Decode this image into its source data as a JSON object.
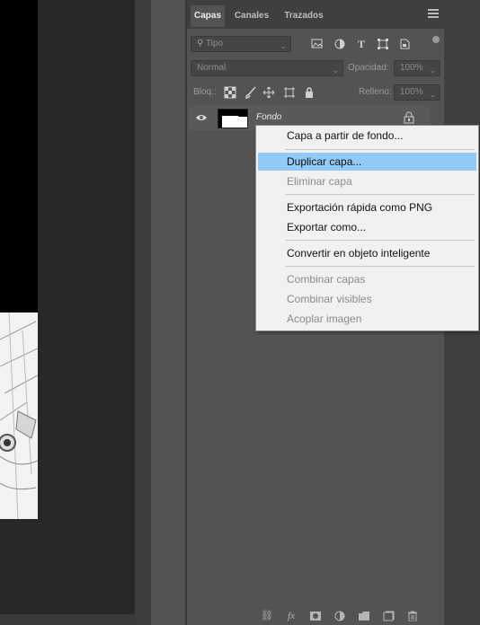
{
  "layers_panel": {
    "tabs": [
      {
        "label": "Capas",
        "active": true
      },
      {
        "label": "Canales",
        "active": false
      },
      {
        "label": "Trazados",
        "active": false
      }
    ],
    "filter": {
      "placeholder": "Tipo"
    },
    "blend_mode": {
      "value": "Normal"
    },
    "opacity": {
      "label": "Opacidad:",
      "value": "100%"
    },
    "lock_label": "Bloq.:",
    "fill": {
      "label": "Relleno:",
      "value": "100%"
    },
    "layers": [
      {
        "name": "Fondo",
        "visible": true,
        "locked": true
      }
    ],
    "filter_icons": [
      "image-filter-icon",
      "adjustment-filter-icon",
      "type-filter-icon",
      "shape-filter-icon",
      "smart-object-filter-icon"
    ],
    "bottom_icons": [
      "link-icon",
      "fx-icon",
      "mask-icon",
      "adjustment-icon",
      "folder-icon",
      "new-layer-icon",
      "trash-icon"
    ]
  },
  "context_menu": {
    "items": [
      {
        "label": "Capa a partir de fondo...",
        "enabled": true,
        "highlighted": false
      },
      {
        "label": "Duplicar capa...",
        "enabled": true,
        "highlighted": true
      },
      {
        "label": "Eliminar capa",
        "enabled": false,
        "highlighted": false
      },
      {
        "label": "Exportación rápida como PNG",
        "enabled": true,
        "highlighted": false
      },
      {
        "label": "Exportar como...",
        "enabled": true,
        "highlighted": false
      },
      {
        "label": "Convertir en objeto inteligente",
        "enabled": true,
        "highlighted": false
      },
      {
        "label": "Combinar capas",
        "enabled": false,
        "highlighted": false
      },
      {
        "label": "Combinar visibles",
        "enabled": false,
        "highlighted": false
      },
      {
        "label": "Acoplar imagen",
        "enabled": false,
        "highlighted": false
      }
    ],
    "highlight_color": "#91c9f7"
  },
  "colors": {
    "panel_bg": "#535353",
    "canvas_bg": "#282828",
    "menu_bg": "#f1f1f1"
  }
}
